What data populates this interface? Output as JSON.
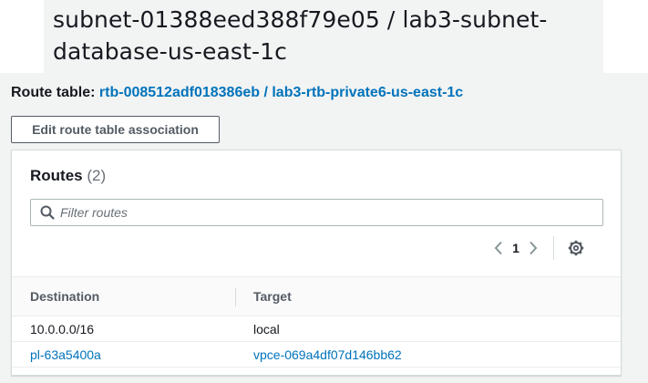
{
  "subnet": {
    "title_line1": "subnet-01388eed388f79e05 / lab3-subnet-",
    "title_line2": "database-us-east-1c"
  },
  "route_table": {
    "label": "Route table:",
    "link": "rtb-008512adf018386eb / lab3-rtb-private6-us-east-1c"
  },
  "edit_button_label": "Edit route table association",
  "routes": {
    "title": "Routes",
    "count": "(2)",
    "filter_placeholder": "Filter routes",
    "page": "1",
    "columns": [
      "Destination",
      "Target"
    ],
    "rows": [
      {
        "destination": "10.0.0.0/16",
        "target": "local"
      },
      {
        "destination": "pl-63a5400a",
        "target": "vpce-069a4df07d146bb62"
      }
    ]
  },
  "icons": [
    "search-icon",
    "chevron-left-icon",
    "chevron-right-icon",
    "gear-icon"
  ],
  "colors": {
    "link": "#0073bb",
    "text": "#16191f",
    "muted": "#687078",
    "border": "#d5dbdb"
  }
}
